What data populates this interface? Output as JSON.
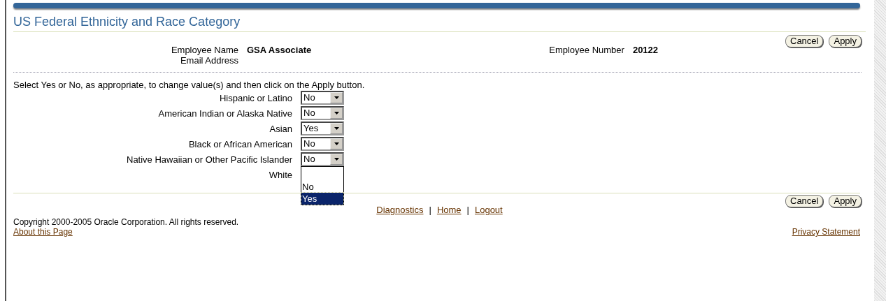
{
  "title": "US Federal Ethnicity and Race Category",
  "top_buttons": [
    {
      "label": "Cancel"
    },
    {
      "label": "Apply"
    }
  ],
  "employee_fields": [
    {
      "label": "Employee Name",
      "value": "GSA Associate"
    },
    {
      "label": "Email Address"
    }
  ],
  "employee_number": {
    "label": "Employee Number",
    "value": "20122"
  },
  "instruction": "Select Yes or No, as appropriate, to change value(s) and then click on the Apply button.",
  "questions": [
    {
      "label": "Hispanic or Latino",
      "kind": "select",
      "value": "No"
    },
    {
      "label": "American Indian or Alaska Native",
      "kind": "select",
      "value": "No"
    },
    {
      "label": "Asian",
      "kind": "select",
      "value": "Yes"
    },
    {
      "label": "Black or African American",
      "kind": "select",
      "value": "No"
    },
    {
      "label": "Native Hawaiian or Other Pacific Islander",
      "kind": "select",
      "value": "No"
    },
    {
      "label": "White",
      "kind": "open_list",
      "options": [
        {
          "label": "No",
          "selected": false
        },
        {
          "label": "Yes",
          "selected": true
        }
      ]
    }
  ],
  "bottom_buttons": [
    {
      "label": "Cancel"
    },
    {
      "label": "Apply"
    }
  ],
  "footer_links": [
    {
      "label": "Diagnostics"
    },
    {
      "label": "Home"
    },
    {
      "label": "Logout"
    }
  ],
  "footer_separator": "|",
  "copyright": "Copyright 2000-2005 Oracle Corporation. All rights reserved.",
  "about_link": "About this Page",
  "privacy_link": "Privacy Statement"
}
